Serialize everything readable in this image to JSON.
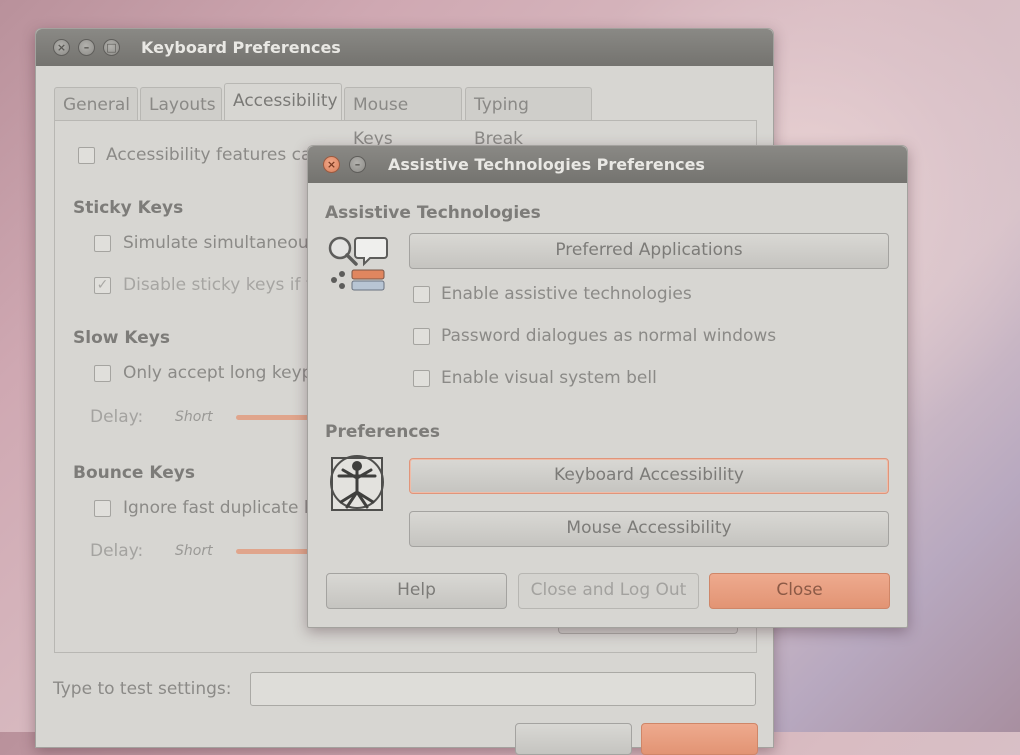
{
  "keyboard_window": {
    "title": "Keyboard Preferences",
    "tabs": [
      "General",
      "Layouts",
      "Accessibility",
      "Mouse Keys",
      "Typing Break"
    ],
    "active_tab": "Accessibility",
    "accessibility_features_label": "Accessibility features ca",
    "sticky_keys": {
      "heading": "Sticky Keys",
      "simulate_label": "Simulate simultaneou",
      "disable_label": "Disable sticky keys if t"
    },
    "slow_keys": {
      "heading": "Slow Keys",
      "only_accept_label": "Only accept long keyp",
      "delay_label": "Delay:",
      "short_label": "Short"
    },
    "bounce_keys": {
      "heading": "Bounce Keys",
      "ignore_label": "Ignore fast duplicate k",
      "delay_label": "Delay:",
      "short_label": "Short"
    },
    "type_to_test_label": "Type to test settings:",
    "type_to_test_value": ""
  },
  "assistive_dialog": {
    "title": "Assistive Technologies Preferences",
    "assistive_heading": "Assistive Technologies",
    "preferred_applications_button": "Preferred Applications",
    "enable_assistive_label": "Enable assistive technologies",
    "password_dialogues_label": "Password dialogues as normal windows",
    "visual_bell_label": "Enable visual system bell",
    "preferences_heading": "Preferences",
    "keyboard_accessibility_button": "Keyboard Accessibility",
    "mouse_accessibility_button": "Mouse Accessibility",
    "help_button": "Help",
    "close_logout_button": "Close and Log Out",
    "close_button": "Close"
  },
  "colors": {
    "accent_orange": "#e29474",
    "titlebar": "#7f7e7a",
    "window_bg": "#d7d6d2"
  },
  "icons": [
    "close-icon",
    "minimize-icon",
    "maximize-icon",
    "assistive-technologies-icon",
    "vitruvian-man-icon"
  ]
}
